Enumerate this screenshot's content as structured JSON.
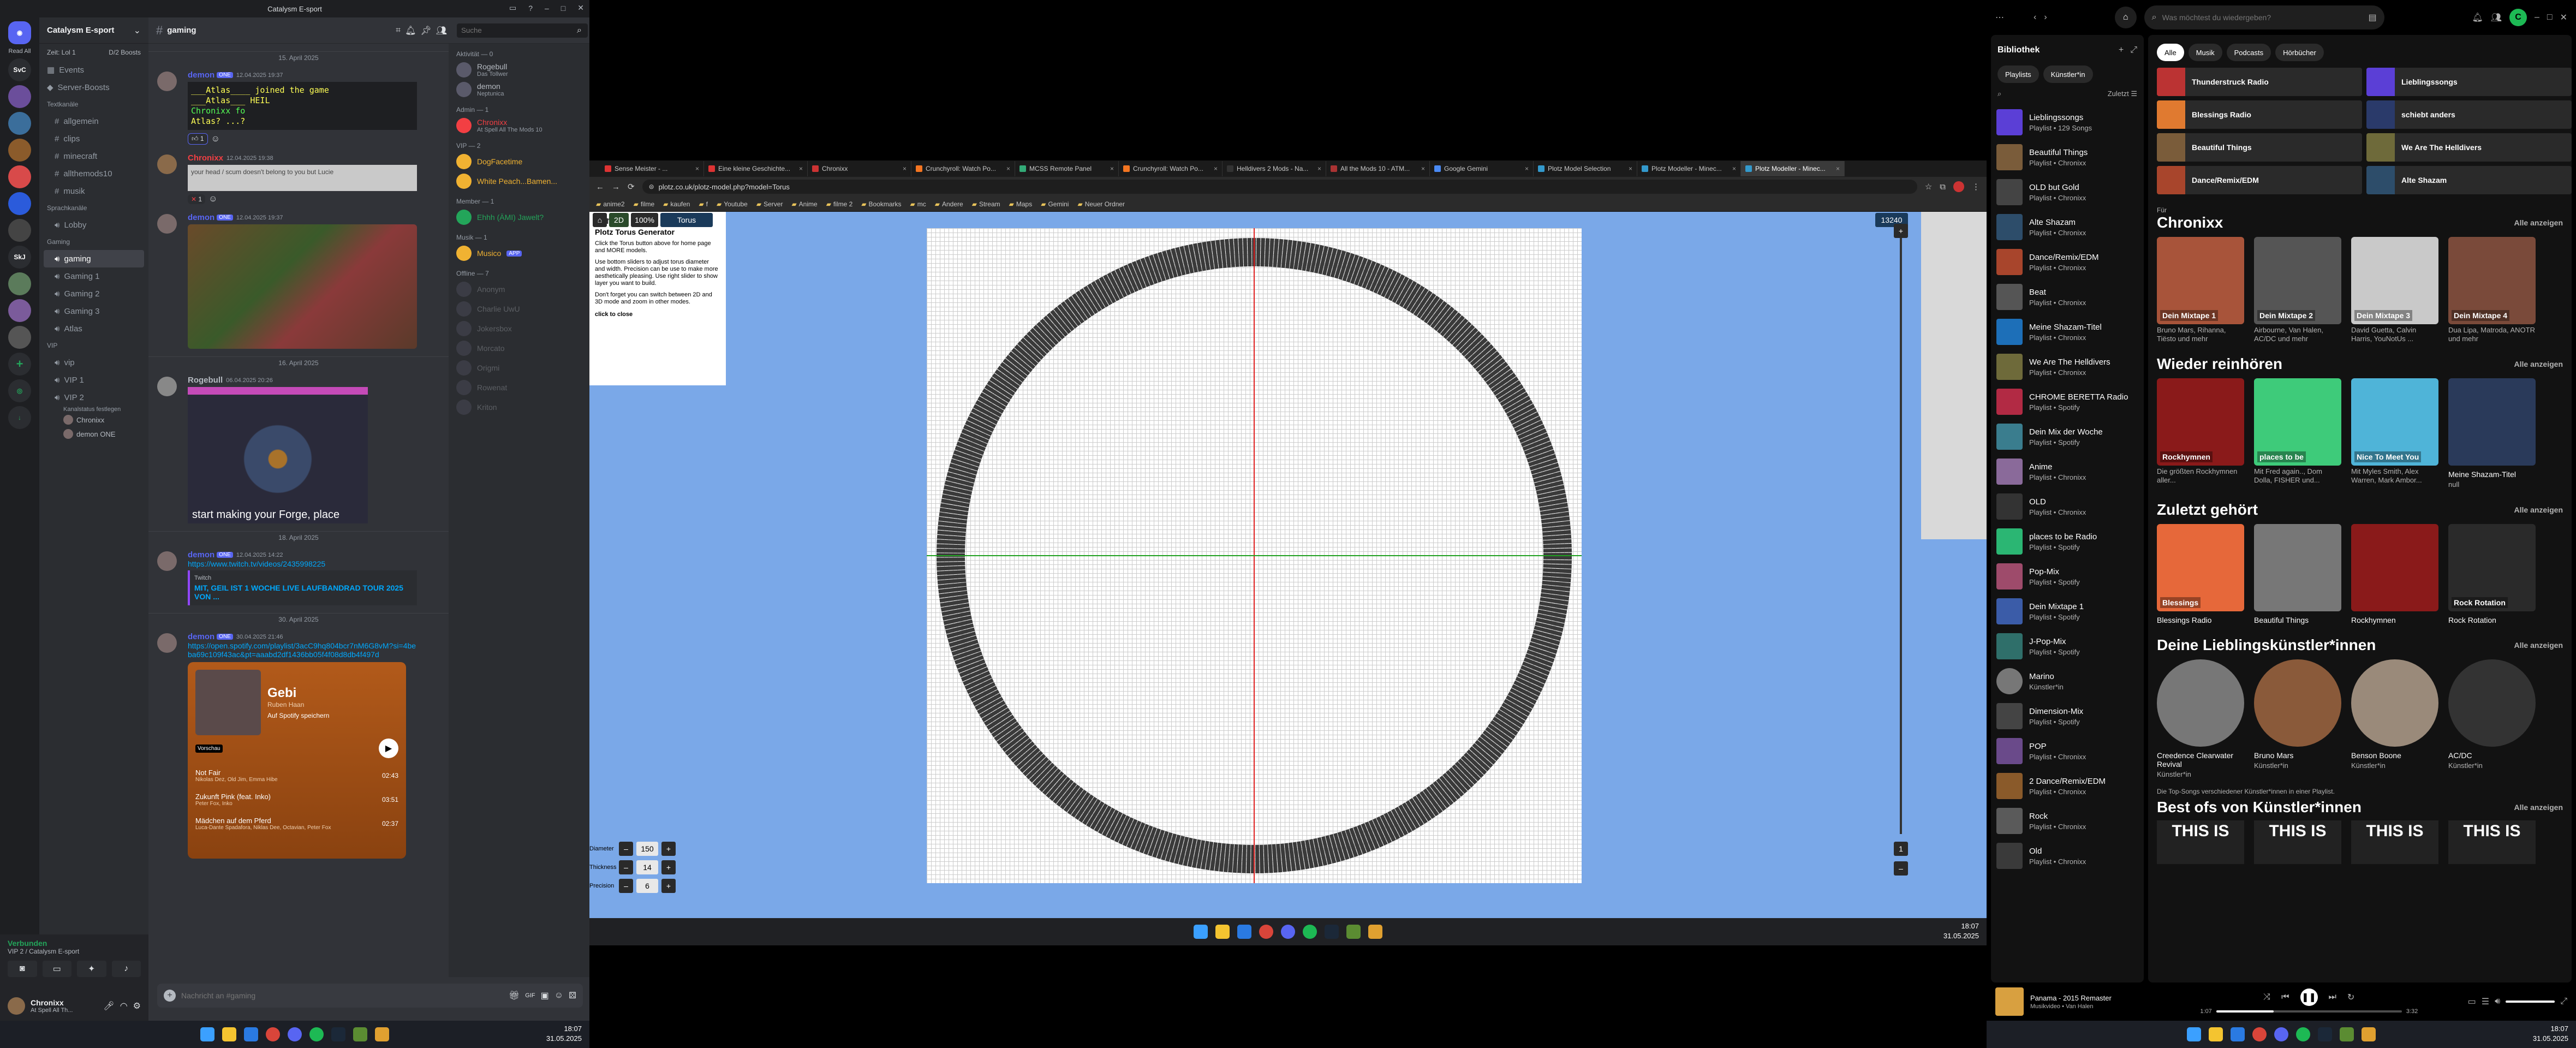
{
  "discord": {
    "window_title": "Catalysm E-sport",
    "server_name": "Catalysm E-sport",
    "read_all": "Read All",
    "servers": [
      "SvC",
      "SkJ"
    ],
    "event_row": [
      "Zeit: Lol 1",
      "D/2 Boosts"
    ],
    "top_items": [
      "Events",
      "Server-Boosts"
    ],
    "categories": [
      {
        "name": "Textkanäle",
        "channels": [
          "allgemein",
          "clips",
          "minecraft",
          "allthemods10",
          "musik"
        ]
      },
      {
        "name": "Sprachkanäle",
        "channels": [
          "Lobby"
        ]
      },
      {
        "name": "Gaming",
        "channels": [
          "gaming",
          "Gaming 1",
          "Gaming 2",
          "Gaming 3",
          "Atlas"
        ]
      },
      {
        "name": "VIP",
        "channels": [
          "vip",
          "VIP 1",
          "VIP 2"
        ]
      }
    ],
    "vip2_sub": "Kanalstatus festlegen",
    "vip2_users": [
      "Chronixx",
      "demon ONE"
    ],
    "channel_header": "gaming",
    "search_placeholder": "Suche",
    "messages": [
      {
        "user": "demon",
        "tag": "ONE",
        "time": "12.04.2025 19:37",
        "ascii": [
          "___Atlas____ joined the game",
          "___Atlas___ HEIL",
          "Chronixx fo",
          "Atlas? ...?"
        ],
        "reactions": [
          "1",
          ""
        ]
      },
      {
        "user": "Chronixx",
        "time": "12.04.2025 19:38",
        "quote": "your head / scum doesn't belong to you but Lucie",
        "reactions": [
          "1"
        ]
      },
      {
        "user": "demon",
        "tag": "ONE",
        "time": "12.04.2025 19:37"
      },
      {
        "user": "Rogebull",
        "time": "06.04.2025 20:26",
        "caption": "start making your Forge, place"
      },
      {
        "user": "demon",
        "tag": "ONE",
        "time": "12.04.2025 14:22",
        "link": "https://www.twitch.tv/videos/2435998225",
        "embed_site": "Twitch",
        "embed_title": "MIT, GEIL IST 1 WOCHE LIVE LAUFBANDRAD TOUR 2025 VON ..."
      },
      {
        "user": "demon",
        "tag": "ONE",
        "time": "30.04.2025 21:46",
        "link": "https://open.spotify.com/playlist/3acC9hq804bcr7nM6G8vM?si=4beba69c109f43ac&pt=aaabd2df1436bb05f4f08d8db4f497d"
      }
    ],
    "date_separators": [
      "15. April 2025",
      "16. April 2025",
      "18. April 2025",
      "30. April 2025"
    ],
    "spotify_embed": {
      "title": "Gebi",
      "artist": "Ruben Haan",
      "save": "Auf Spotify speichern",
      "badge": "Vorschau",
      "tracks": [
        {
          "name": "Not Fair",
          "artists": "Nikolas Dez, Old Jim, Emma Hibe",
          "dur": "02:43"
        },
        {
          "name": "Zukunft Pink (feat. Inko)",
          "artists": "Peter Fox, Inko",
          "dur": "03:51"
        },
        {
          "name": "Mädchen auf dem Pferd",
          "artists": "Luca-Dante Spadafora, Niklas Dee, Octavian, Peter Fox",
          "dur": "02:37"
        }
      ]
    },
    "composer_placeholder": "Nachricht an #gaming",
    "voice": {
      "status": "Verbunden",
      "channel": "VIP 2 / Catalysm E-sport"
    },
    "user": {
      "name": "Chronixx",
      "status": "At Spell All Th..."
    },
    "members": [
      {
        "cat": "Aktivität — 0"
      },
      {
        "name": "Rogebull",
        "sub": "Das Tollwer"
      },
      {
        "name": "demon",
        "sub": "Neptunica"
      },
      {
        "cat": "Admin — 1"
      },
      {
        "name": "Chronixx",
        "sub": "At Spell All The Mods 10",
        "color": "#f23f43"
      },
      {
        "cat": "VIP — 2"
      },
      {
        "name": "DogFacetime",
        "color": "#f0b232"
      },
      {
        "name": "White Peach...Bamen...",
        "color": "#f0b232"
      },
      {
        "cat": "Member — 1"
      },
      {
        "name": "Ehhh (ÄMI) Jawelt?",
        "color": "#23a55a"
      },
      {
        "cat": "Musik — 1"
      },
      {
        "name": "Musico",
        "color": "#f0b232",
        "badge": "APP"
      },
      {
        "cat": "Offline — 7"
      },
      {
        "name": "Anonym"
      },
      {
        "name": "Charlie UwU"
      },
      {
        "name": "Jokersbox"
      },
      {
        "name": "Morcato"
      },
      {
        "name": "Origmi"
      },
      {
        "name": "Rowenat"
      },
      {
        "name": "Kriton"
      }
    ]
  },
  "browser": {
    "tabs": [
      "Sense Meister - ...",
      "Eine kleine Geschichte...",
      "Chronixx",
      "Crunchyroll: Watch Po...",
      "MCSS Remote Panel",
      "Crunchyroll: Watch Po...",
      "Helldivers 2 Mods - Na...",
      "All the Mods 10 - ATM...",
      "Google Gemini",
      "Plotz Model Selection",
      "Plotz Modeller - Minec...",
      "Plotz Modeller - Minec..."
    ],
    "url": "plotz.co.uk/plotz-model.php?model=Torus",
    "bookmarks": [
      "anime2",
      "filme",
      "kaufen",
      "f",
      "Youtube",
      "Server",
      "Anime",
      "filme 2",
      "Bookmarks",
      "mc",
      "Andere",
      "Stream",
      "Maps",
      "Gemini",
      "Neuer Ordner"
    ],
    "toolbar": {
      "mode": "2D",
      "zoom": "100%",
      "shape": "Torus",
      "layer": "13240"
    },
    "info_title": "Plotz Torus Generator",
    "info_paragraphs": [
      "Click the Torus button above for home page and MORE models.",
      "Use bottom sliders to adjust torus diameter and width. Precision can be use to make more aesthetically pleasing. Use right slider to show layer you want to build.",
      "Don't forget you can switch between 2D and 3D mode and zoom in other modes."
    ],
    "close_label": "click to close",
    "controls": [
      {
        "label": "Diameter",
        "value": "150"
      },
      {
        "label": "Thickness",
        "value": "14"
      },
      {
        "label": "Precision",
        "value": "6"
      }
    ],
    "slider_value": "1",
    "clock": {
      "time": "18:07",
      "date": "31.05.2025"
    }
  },
  "spotify": {
    "search_placeholder": "Was möchtest du wiedergeben?",
    "avatar_letter": "C",
    "library_title": "Bibliothek",
    "filters": [
      "Playlists",
      "Künstler*in"
    ],
    "recent": "Zuletzt",
    "library": [
      {
        "t": "Lieblingssongs",
        "s": "Playlist • 129 Songs",
        "c": "#5b3fd6"
      },
      {
        "t": "Beautiful Things",
        "s": "Playlist • Chronixx",
        "c": "#7a5c3a"
      },
      {
        "t": "OLD but Gold",
        "s": "Playlist • Chronixx",
        "c": "#444"
      },
      {
        "t": "Alte Shazam",
        "s": "Playlist • Chronixx",
        "c": "#2d4d6a"
      },
      {
        "t": "Dance/Remix/EDM",
        "s": "Playlist • Chronixx",
        "c": "#a8452c"
      },
      {
        "t": "Beat",
        "s": "Playlist • Chronixx",
        "c": "#555"
      },
      {
        "t": "Meine Shazam-Titel",
        "s": "Playlist • Chronixx",
        "c": "#1d6fb8"
      },
      {
        "t": "We Are The Helldivers",
        "s": "Playlist • Chronixx",
        "c": "#6e6a3a"
      },
      {
        "t": "CHROME BERETTA Radio",
        "s": "Playlist • Spotify",
        "c": "#b22a44"
      },
      {
        "t": "Dein Mix der Woche",
        "s": "Playlist • Spotify",
        "c": "#3a7d8e"
      },
      {
        "t": "Anime",
        "s": "Playlist • Chronixx",
        "c": "#8a6a9a"
      },
      {
        "t": "OLD",
        "s": "Playlist • Chronixx",
        "c": "#333"
      },
      {
        "t": "places to be Radio",
        "s": "Playlist • Spotify",
        "c": "#2bb673"
      },
      {
        "t": "Pop-Mix",
        "s": "Playlist • Spotify",
        "c": "#9e4b6b"
      },
      {
        "t": "Dein Mixtape 1",
        "s": "Playlist • Spotify",
        "c": "#3b5ca8"
      },
      {
        "t": "J-Pop-Mix",
        "s": "Playlist • Spotify",
        "c": "#2f6f6a"
      },
      {
        "t": "Marino",
        "s": "Künstler*in",
        "c": "#777"
      },
      {
        "t": "Dimension-Mix",
        "s": "Playlist • Spotify",
        "c": "#444"
      },
      {
        "t": "POP",
        "s": "Playlist • Chronixx",
        "c": "#6a4a8a"
      },
      {
        "t": "2 Dance/Remix/EDM",
        "s": "Playlist • Chronixx",
        "c": "#8a5a2a"
      },
      {
        "t": "Rock",
        "s": "Playlist • Chronixx",
        "c": "#5a5a5a"
      },
      {
        "t": "Old",
        "s": "Playlist • Chronixx",
        "c": "#3a3a3a"
      }
    ],
    "chips": [
      "Alle",
      "Musik",
      "Podcasts",
      "Hörbücher"
    ],
    "quick": [
      {
        "t": "Thunderstruck Radio",
        "c": "#b33"
      },
      {
        "t": "Lieblingssongs",
        "c": "#5b3fd6"
      },
      {
        "t": "Blessings Radio",
        "c": "#e07a30"
      },
      {
        "t": "schiebt anders",
        "c": "#2a3a6a"
      },
      {
        "t": "Beautiful Things",
        "c": "#7a5c3a"
      },
      {
        "t": "We Are The Helldivers",
        "c": "#6e6a3a"
      },
      {
        "t": "Dance/Remix/EDM",
        "c": "#a8452c"
      },
      {
        "t": "Alte Shazam",
        "c": "#2d4d6a"
      }
    ],
    "sections": [
      {
        "small": "Für",
        "title": "Chronixx",
        "show": "Alle anzeigen",
        "cards": [
          {
            "t": "",
            "s": "Bruno Mars, Rihanna, Tiësto und mehr",
            "label": "Dein Mixtape 1",
            "c": "#a8543a"
          },
          {
            "t": "",
            "s": "Airbourne, Van Halen, AC/DC und mehr",
            "label": "Dein Mixtape 2",
            "c": "#555"
          },
          {
            "t": "",
            "s": "David Guetta, Calvin Harris, YouNotUs ...",
            "label": "Dein Mixtape 3",
            "c": "#c9c9c9"
          },
          {
            "t": "",
            "s": "Dua Lipa, Matroda, ANOTR und mehr",
            "label": "Dein Mixtape 4",
            "c": "#7a4a3a"
          }
        ]
      },
      {
        "title": "Wieder reinhören",
        "show": "Alle anzeigen",
        "cards": [
          {
            "t": "",
            "s": "Die größten Rockhymnen aller...",
            "label": "Rockhymnen",
            "c": "#8a1a1a"
          },
          {
            "t": "",
            "s": "Mit Fred again.., Dom Dolla, FISHER und...",
            "label": "places to be",
            "c": "#3ecb7a"
          },
          {
            "t": "",
            "s": "Mit Myles Smith, Alex Warren, Mark Ambor...",
            "label": "Nice To Meet You",
            "c": "#4fb4d8"
          },
          {
            "t": "Meine Shazam-Titel",
            "s": "null",
            "label": "",
            "c": "#2a3a5a"
          }
        ]
      },
      {
        "title": "Zuletzt gehört",
        "show": "Alle anzeigen",
        "cards": [
          {
            "t": "Blessings Radio",
            "s": "",
            "label": "Blessings",
            "c": "#e6683a"
          },
          {
            "t": "Beautiful Things",
            "s": "",
            "label": "",
            "c": "#777"
          },
          {
            "t": "Rockhymnen",
            "s": "",
            "label": "",
            "c": "#8a1a1a"
          },
          {
            "t": "Rock Rotation",
            "s": "",
            "label": "Rock Rotation",
            "c": "#2a2a2a"
          }
        ]
      },
      {
        "title": "Deine Lieblingskünstler*innen",
        "show": "Alle anzeigen",
        "round": true,
        "cards": [
          {
            "t": "Creedence Clearwater Revival",
            "s": "Künstler*in",
            "c": "#777"
          },
          {
            "t": "Bruno Mars",
            "s": "Künstler*in",
            "c": "#8a5a3a"
          },
          {
            "t": "Benson Boone",
            "s": "Künstler*in",
            "c": "#9a8a7a"
          },
          {
            "t": "AC/DC",
            "s": "Künstler*in",
            "c": "#333"
          }
        ]
      }
    ],
    "best_of_hint": "Die Top-Songs verschiedener Künstler*innen in einer Playlist.",
    "best_of_title": "Best ofs von Künstler*innen",
    "best_of_label": "THIS IS",
    "now_playing": {
      "title": "Panama - 2015 Remaster",
      "artist": "Musikvideo • Van Halen",
      "elapsed": "1:07",
      "total": "3:32",
      "progress": 0.31
    },
    "clock": {
      "time": "18:07",
      "date": "31.05.2025"
    }
  }
}
